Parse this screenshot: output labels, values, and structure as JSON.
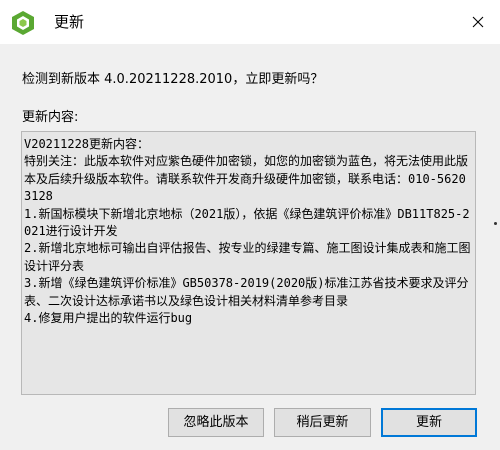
{
  "window": {
    "title": "更新"
  },
  "prompt": "检测到新版本 4.0.20211228.2010，立即更新吗？",
  "notes": {
    "label": "更新内容:",
    "lines": [
      "V20211228更新内容：",
      "特别关注：此版本软件对应紫色硬件加密锁，如您的加密锁为蓝色，将无法使用此版本及后续升级版本软件。请联系软件开发商升级硬件加密锁，联系电话：010-56203128",
      "1.新国标模块下新增北京地标（2021版），依据《绿色建筑评价标准》DB11T825-2021进行设计开发",
      "2.新增北京地标可输出自评估报告、按专业的绿建专篇、施工图设计集成表和施工图设计评分表",
      "3.新增《绿色建筑评价标准》GB50378-2019(2020版)标准江苏省技术要求及评分表、二次设计达标承诺书以及绿色设计相关材料清单参考目录",
      "4.修复用户提出的软件运行bug"
    ]
  },
  "buttons": {
    "ignore": "忽略此版本",
    "later": "稍后更新",
    "update": "更新"
  },
  "icons": {
    "app": "app-logo-icon",
    "close": "close-icon"
  },
  "colors": {
    "accent": "#0078d7",
    "logo_green": "#5aa832"
  }
}
